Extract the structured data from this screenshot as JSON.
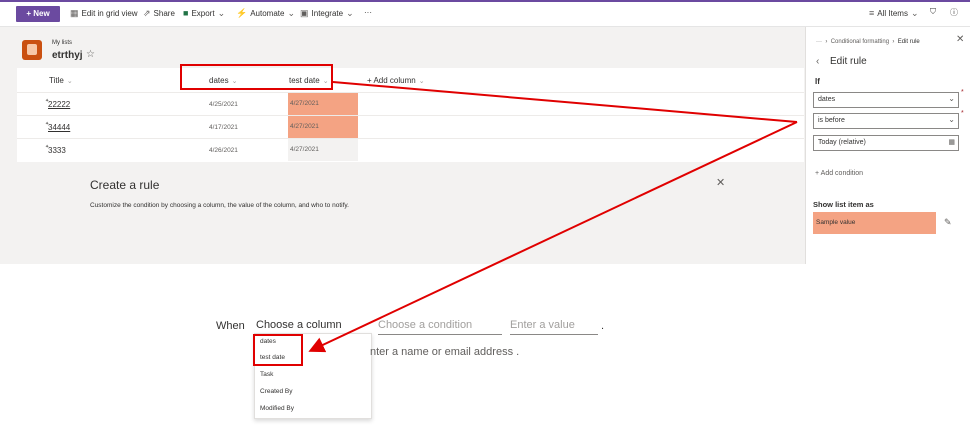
{
  "commandbar": {
    "new_label": "New",
    "edit_grid_label": "Edit in grid view",
    "share_label": "Share",
    "export_label": "Export",
    "automate_label": "Automate",
    "integrate_label": "Integrate",
    "more_label": "···",
    "all_items_label": "All Items"
  },
  "site": {
    "subtitle": "My lists",
    "title": "etrthyj"
  },
  "list": {
    "columns": {
      "title": "Title",
      "dates": "dates",
      "test_date": "test date",
      "add_column": "+ Add column"
    },
    "rows": [
      {
        "title": "22222",
        "dates": "4/25/2021",
        "test_date": "4/27/2021"
      },
      {
        "title": "34444",
        "dates": "4/17/2021",
        "test_date": "4/27/2021"
      },
      {
        "title": "3333",
        "dates": "4/26/2021",
        "test_date": "4/27/2021"
      }
    ]
  },
  "create_rule": {
    "title": "Create a rule",
    "description": "Customize the condition by choosing a column, the value of the column, and who to notify."
  },
  "side_panel": {
    "breadcrumb_more": "···",
    "breadcrumb_parent": "Conditional formatting",
    "breadcrumb_current": "Edit rule",
    "heading": "Edit rule",
    "if_label": "If",
    "field_value": "dates",
    "operator_value": "is before",
    "date_value": "Today (relative)",
    "add_condition_label": "Add condition",
    "show_as_label": "Show list item as",
    "sample_value": "Sample value"
  },
  "when_row": {
    "when_label": "When",
    "choose_column": "Choose a column",
    "choose_condition": "Choose a condition",
    "enter_value": "Enter a value",
    "period": ".",
    "notify_placeholder": "nter a name or email address ."
  },
  "dropdown_options": [
    "dates",
    "test date",
    "Task",
    "Created By",
    "Modified By"
  ],
  "colors": {
    "accent": "#6b4aa0",
    "highlight": "#f4a383",
    "annotation": "#e00000"
  }
}
